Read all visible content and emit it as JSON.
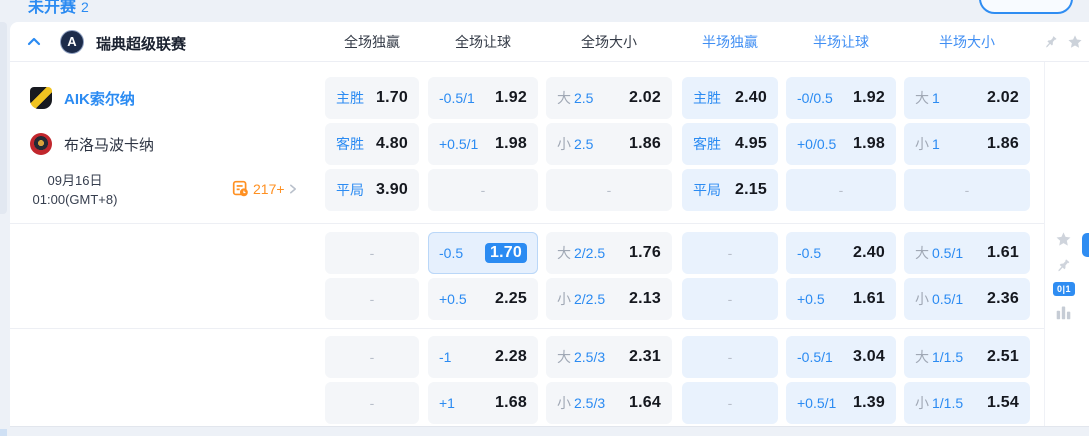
{
  "topbar": {
    "tab_label": "未开赛",
    "tab_count": "2"
  },
  "league": {
    "name": "瑞典超级联赛",
    "logo_letter": "A"
  },
  "columns": [
    {
      "label": "全场独赢"
    },
    {
      "label": "全场让球"
    },
    {
      "label": "全场大小"
    },
    {
      "label": "半场独赢"
    },
    {
      "label": "半场让球"
    },
    {
      "label": "半场大小"
    }
  ],
  "match": {
    "home_name": "AIK索尔纳",
    "away_name": "布洛马波卡纳",
    "date": "09月16日",
    "time": "01:00(GMT+8)",
    "markets_count": "217+"
  },
  "side_rail": {
    "corner_badge": "0|1"
  },
  "colors": {
    "accent": "#2b8bf2",
    "half_cell_bg": "#e9f2fd",
    "full_cell_bg": "#f4f6f9",
    "odds_text": "#15181f",
    "muted_gray": "#a0a8b5",
    "orange": "#ff9021"
  },
  "odds": {
    "blocks": [
      {
        "rows": [
          {
            "cells": [
              {
                "line": "主胜",
                "odds": "1.70"
              },
              {
                "line": "-0.5/1",
                "odds": "1.92"
              },
              {
                "pre": "大",
                "line": "2.5",
                "odds": "2.02"
              },
              {
                "line": "主胜",
                "odds": "2.40"
              },
              {
                "line": "-0/0.5",
                "odds": "1.92"
              },
              {
                "pre": "大",
                "line": "1",
                "odds": "2.02"
              }
            ]
          },
          {
            "cells": [
              {
                "line": "客胜",
                "odds": "4.80"
              },
              {
                "line": "+0.5/1",
                "odds": "1.98"
              },
              {
                "pre": "小",
                "line": "2.5",
                "odds": "1.86"
              },
              {
                "line": "客胜",
                "odds": "4.95"
              },
              {
                "line": "+0/0.5",
                "odds": "1.98"
              },
              {
                "pre": "小",
                "line": "1",
                "odds": "1.86"
              }
            ]
          },
          {
            "cells": [
              {
                "line": "平局",
                "odds": "3.90"
              },
              {
                "dash": "-"
              },
              {
                "dash": "-"
              },
              {
                "line": "平局",
                "odds": "2.15"
              },
              {
                "dash": "-"
              },
              {
                "dash": "-"
              }
            ]
          }
        ]
      },
      {
        "rows": [
          {
            "cells": [
              {
                "dash": "-"
              },
              {
                "line": "-0.5",
                "odds": "1.70",
                "selected": true
              },
              {
                "pre": "大",
                "line": "2/2.5",
                "odds": "1.76"
              },
              {
                "dash": "-"
              },
              {
                "line": "-0.5",
                "odds": "2.40"
              },
              {
                "pre": "大",
                "line": "0.5/1",
                "odds": "1.61"
              }
            ]
          },
          {
            "cells": [
              {
                "dash": "-"
              },
              {
                "line": "+0.5",
                "odds": "2.25"
              },
              {
                "pre": "小",
                "line": "2/2.5",
                "odds": "2.13"
              },
              {
                "dash": "-"
              },
              {
                "line": "+0.5",
                "odds": "1.61"
              },
              {
                "pre": "小",
                "line": "0.5/1",
                "odds": "2.36"
              }
            ]
          }
        ]
      },
      {
        "rows": [
          {
            "cells": [
              {
                "dash": "-"
              },
              {
                "line": "-1",
                "odds": "2.28"
              },
              {
                "pre": "大",
                "line": "2.5/3",
                "odds": "2.31"
              },
              {
                "dash": "-"
              },
              {
                "line": "-0.5/1",
                "odds": "3.04"
              },
              {
                "pre": "大",
                "line": "1/1.5",
                "odds": "2.51"
              }
            ]
          },
          {
            "cells": [
              {
                "dash": "-"
              },
              {
                "line": "+1",
                "odds": "1.68"
              },
              {
                "pre": "小",
                "line": "2.5/3",
                "odds": "1.64"
              },
              {
                "dash": "-"
              },
              {
                "line": "+0.5/1",
                "odds": "1.39"
              },
              {
                "pre": "小",
                "line": "1/1.5",
                "odds": "1.54"
              }
            ]
          }
        ]
      }
    ]
  }
}
